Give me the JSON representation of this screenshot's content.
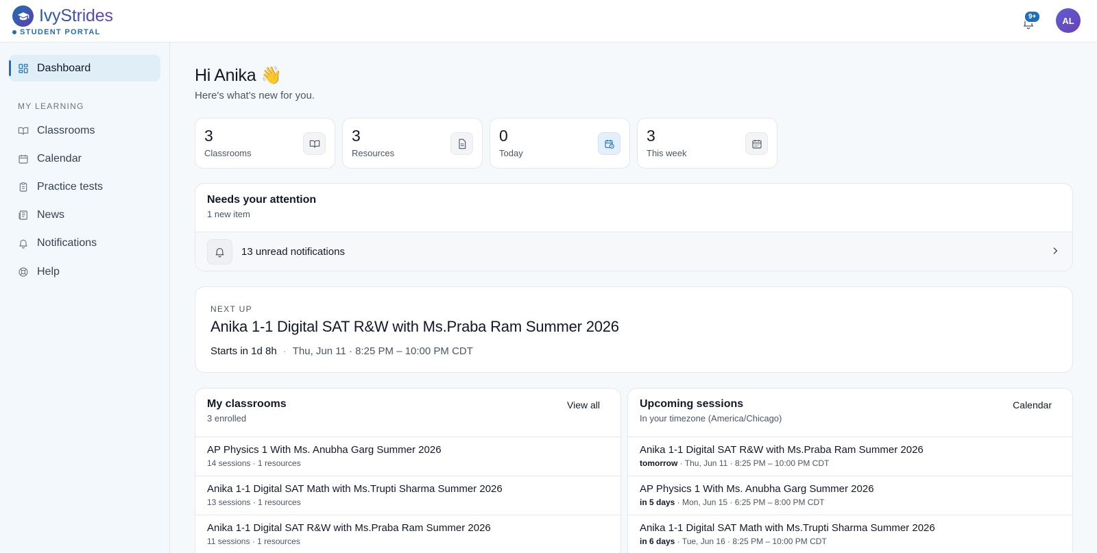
{
  "header": {
    "brand": "IvyStrides",
    "portal_label": "STUDENT PORTAL",
    "notif_badge": "9+",
    "avatar_initials": "AL",
    "accent": "#1d6fb8"
  },
  "sidebar": {
    "section_label": "MY LEARNING",
    "items": [
      {
        "label": "Dashboard",
        "icon": "grid-icon",
        "active": true
      },
      {
        "label": "Classrooms",
        "icon": "book-icon"
      },
      {
        "label": "Calendar",
        "icon": "calendar-icon"
      },
      {
        "label": "Practice tests",
        "icon": "clipboard-icon"
      },
      {
        "label": "News",
        "icon": "newspaper-icon"
      },
      {
        "label": "Notifications",
        "icon": "bell-icon"
      },
      {
        "label": "Help",
        "icon": "lifebuoy-icon"
      }
    ]
  },
  "greeting": {
    "title": "Hi Anika 👋",
    "subtitle": "Here's what's new for you."
  },
  "stats": [
    {
      "value": "3",
      "label": "Classrooms",
      "icon": "book-icon"
    },
    {
      "value": "3",
      "label": "Resources",
      "icon": "document-icon"
    },
    {
      "value": "0",
      "label": "Today",
      "icon": "calendar-clock-icon"
    },
    {
      "value": "3",
      "label": "This week",
      "icon": "calendar-icon"
    }
  ],
  "attention": {
    "title": "Needs your attention",
    "subtitle": "1 new item",
    "row_text": "13 unread notifications"
  },
  "next_up": {
    "kicker": "NEXT UP",
    "title": "Anika 1-1 Digital SAT R&W with Ms.Praba Ram Summer 2026",
    "starts": "Starts in 1d 8h",
    "separator": "·",
    "when": "Thu, Jun 11 · 8:25 PM – 10:00 PM CDT"
  },
  "classrooms": {
    "title": "My classrooms",
    "subtitle": "3 enrolled",
    "action": "View all",
    "items": [
      {
        "title": "AP Physics 1 With Ms. Anubha Garg Summer 2026",
        "meta": "14 sessions · 1 resources"
      },
      {
        "title": "Anika 1-1 Digital SAT Math with Ms.Trupti Sharma Summer 2026",
        "meta": "13 sessions · 1 resources"
      },
      {
        "title": "Anika 1-1 Digital SAT R&W with Ms.Praba Ram Summer 2026",
        "meta": "11 sessions · 1 resources"
      }
    ]
  },
  "sessions": {
    "title": "Upcoming sessions",
    "subtitle": "In your timezone (America/Chicago)",
    "action": "Calendar",
    "items": [
      {
        "title": "Anika 1-1 Digital SAT R&W with Ms.Praba Ram Summer 2026",
        "when": "tomorrow",
        "meta": " · Thu, Jun 11 · 8:25 PM – 10:00 PM CDT"
      },
      {
        "title": "AP Physics 1 With Ms. Anubha Garg Summer 2026",
        "when": "in 5 days",
        "meta": " · Mon, Jun 15 · 6:25 PM – 8:00 PM CDT"
      },
      {
        "title": "Anika 1-1 Digital SAT Math with Ms.Trupti Sharma Summer 2026",
        "when": "in 6 days",
        "meta": " · Tue, Jun 16 · 8:25 PM – 10:00 PM CDT"
      }
    ]
  }
}
